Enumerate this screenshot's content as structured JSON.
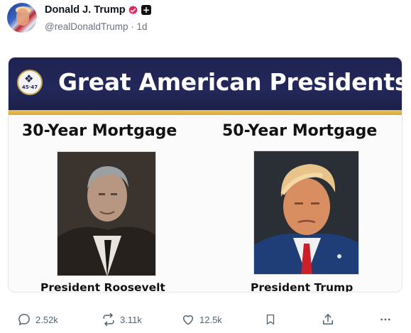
{
  "post": {
    "author": {
      "name": "Donald J. Trump",
      "handle": "@realDonaldTrump",
      "separator": "·",
      "time": "1d"
    },
    "image": {
      "banner_title": "Great American Presidents",
      "seal_text": "45·47",
      "left": {
        "heading": "30-Year Mortgage",
        "caption": "President Roosevelt"
      },
      "right": {
        "heading": "50-Year Mortgage",
        "caption": "President Trump"
      }
    },
    "actions": {
      "replies": "2.52k",
      "reposts": "3.11k",
      "likes": "12.5k"
    }
  },
  "colors": {
    "banner": "#1f2350",
    "gold": "#d6a93a",
    "verified": "#e0245e",
    "action_gray": "#536471"
  },
  "icons": [
    "verified-badge-icon",
    "plus-icon",
    "reply-icon",
    "repost-icon",
    "heart-icon",
    "bookmark-icon",
    "share-icon",
    "more-icon"
  ]
}
